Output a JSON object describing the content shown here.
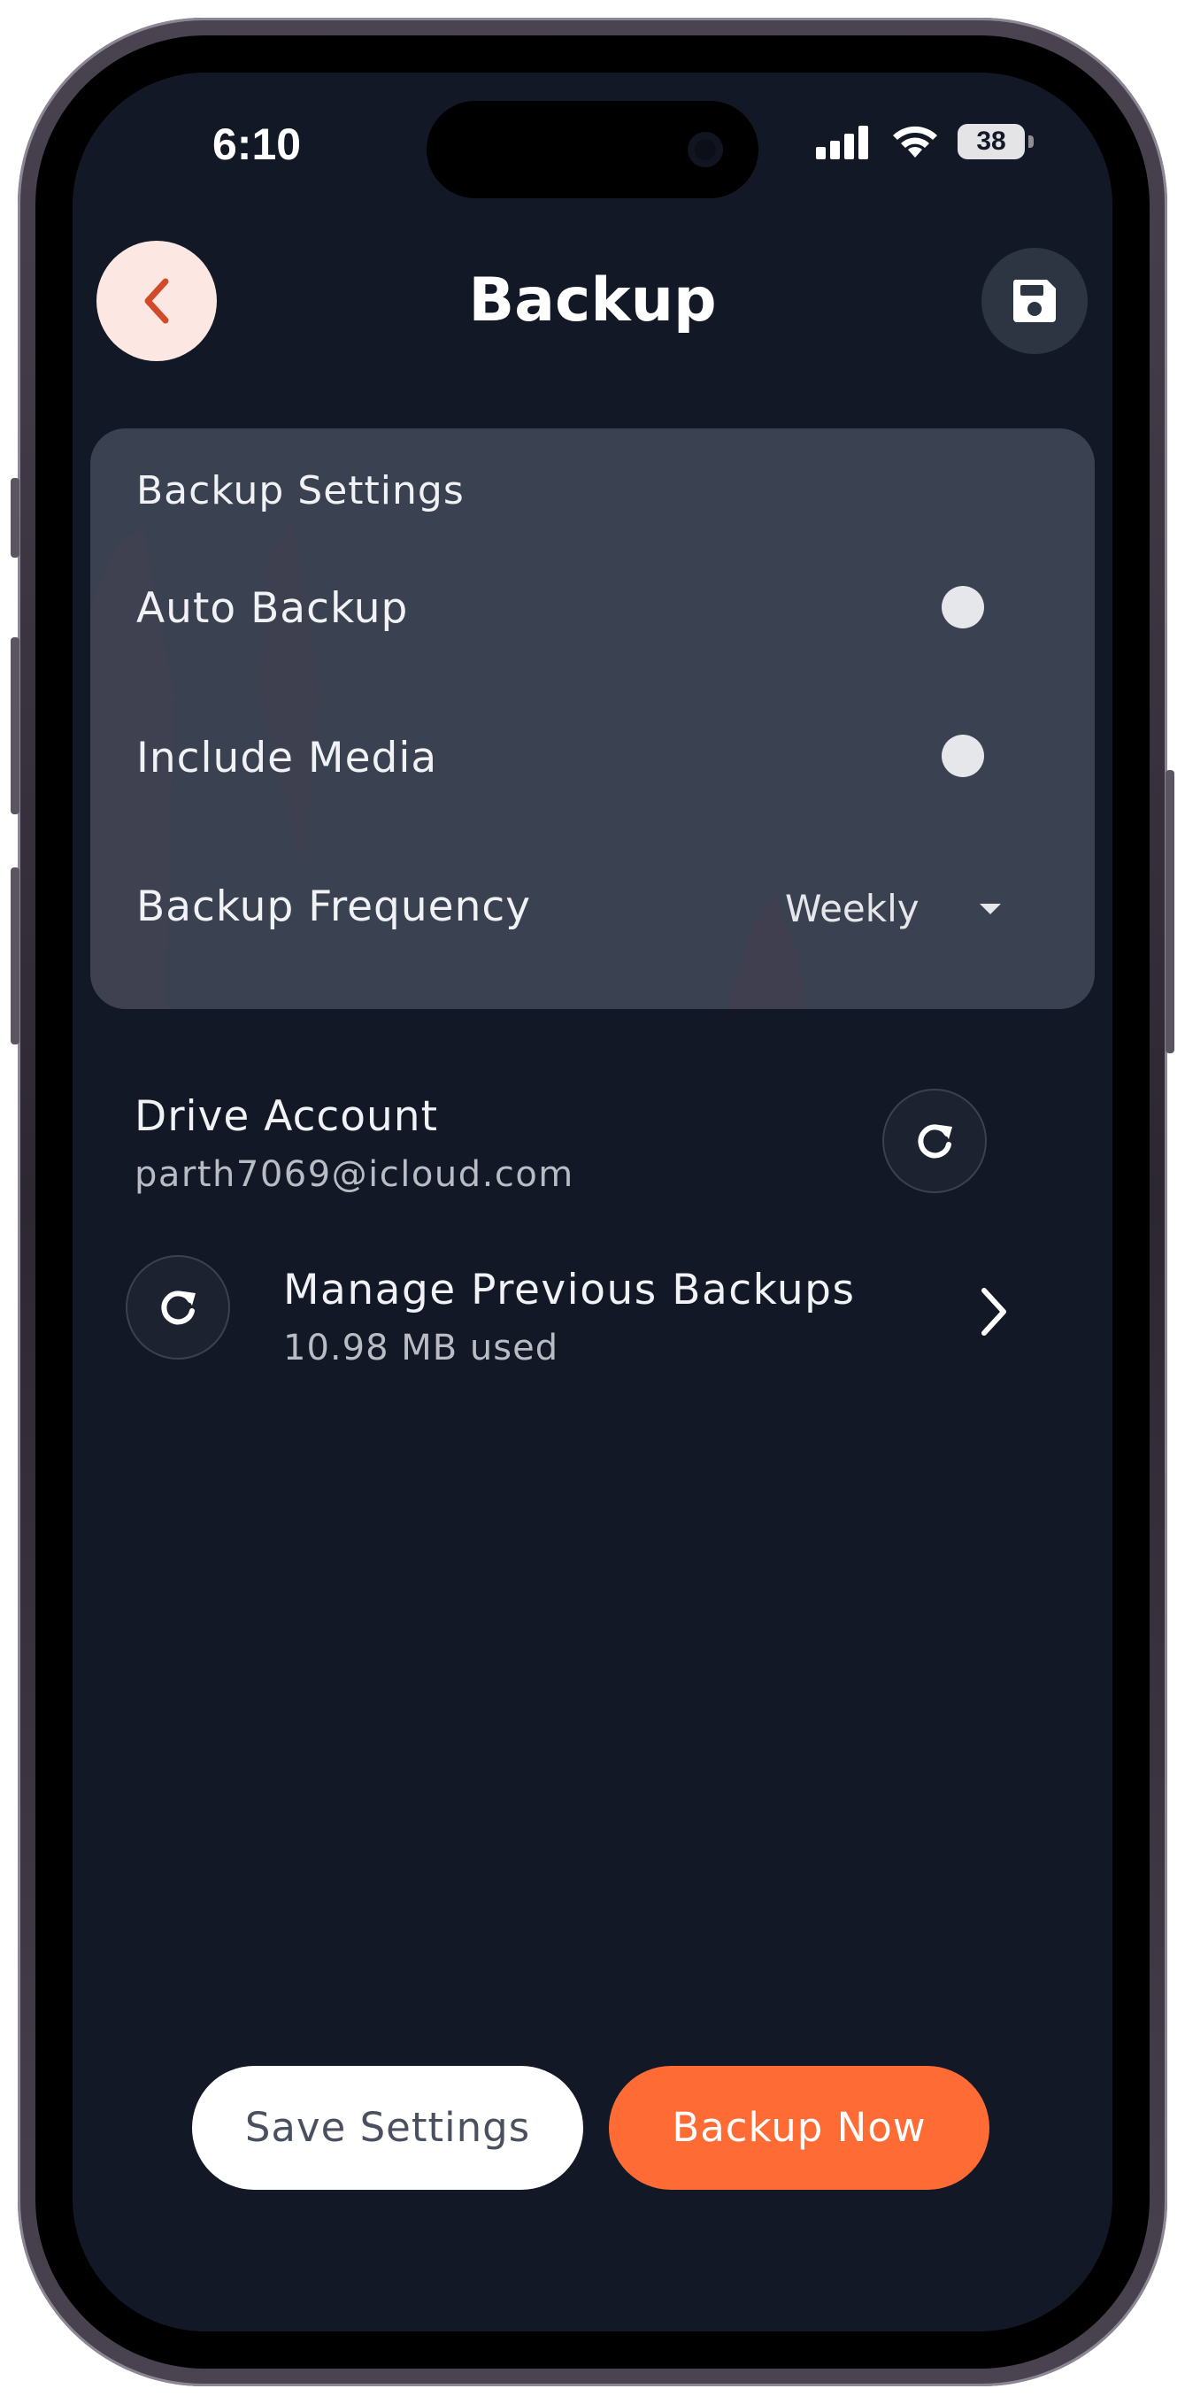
{
  "status_bar": {
    "time": "6:10",
    "battery": "38",
    "icons": [
      "signal-icon",
      "wifi-icon",
      "battery-icon"
    ]
  },
  "header": {
    "title": "Backup",
    "back_icon": "chevron-left-icon",
    "save_icon": "floppy-disk-icon"
  },
  "settings": {
    "title": "Backup Settings",
    "auto_backup_label": "Auto Backup",
    "include_media_label": "Include Media",
    "frequency_label": "Backup Frequency",
    "frequency_value": "Weekly"
  },
  "drive": {
    "label": "Drive Account",
    "email": "parth7069@icloud.com",
    "refresh_icon": "refresh-icon"
  },
  "previous_backups": {
    "label": "Manage Previous Backups",
    "usage": "10.98 MB used",
    "icon": "refresh-icon",
    "chevron_icon": "chevron-right-icon"
  },
  "actions": {
    "save_settings": "Save Settings",
    "backup_now": "Backup Now"
  },
  "colors": {
    "background": "#131826",
    "card": "#3a4150",
    "accent": "#ff6b35",
    "back_button_bg": "#fde7e3",
    "back_icon": "#d14a2a"
  }
}
